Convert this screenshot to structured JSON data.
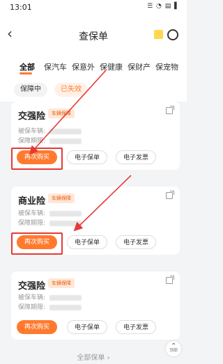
{
  "status": {
    "time": "13:01",
    "icons": "☰ ◔ ▤ ▌"
  },
  "header": {
    "title": "查保单"
  },
  "tabs": [
    "全部",
    "保汽车",
    "保意外",
    "保健康",
    "保财产",
    "保宠物"
  ],
  "filters": [
    "保障中",
    "已失效"
  ],
  "cards": [
    {
      "title": "交强险",
      "tag": "车辆保障",
      "row1": "被保车辆:",
      "row2": "保障期限:",
      "buy": "再次购买",
      "policy": "电子保单",
      "invoice": "电子发票"
    },
    {
      "title": "商业险",
      "tag": "车辆保障",
      "row1": "被保车辆:",
      "row2": "保障期限:",
      "buy": "再次购买",
      "policy": "电子保单",
      "invoice": "电子发票"
    },
    {
      "title": "交强险",
      "tag": "车辆保障",
      "row1": "被保车辆:",
      "row2": "保障期限:",
      "buy": "再次购买",
      "policy": "电子保单",
      "invoice": "电子发票"
    }
  ],
  "footer": {
    "all": "全部保单 ›",
    "top": "顶部"
  },
  "colors": {
    "accent": "#ff7a2f",
    "annotation": "#e53935"
  }
}
